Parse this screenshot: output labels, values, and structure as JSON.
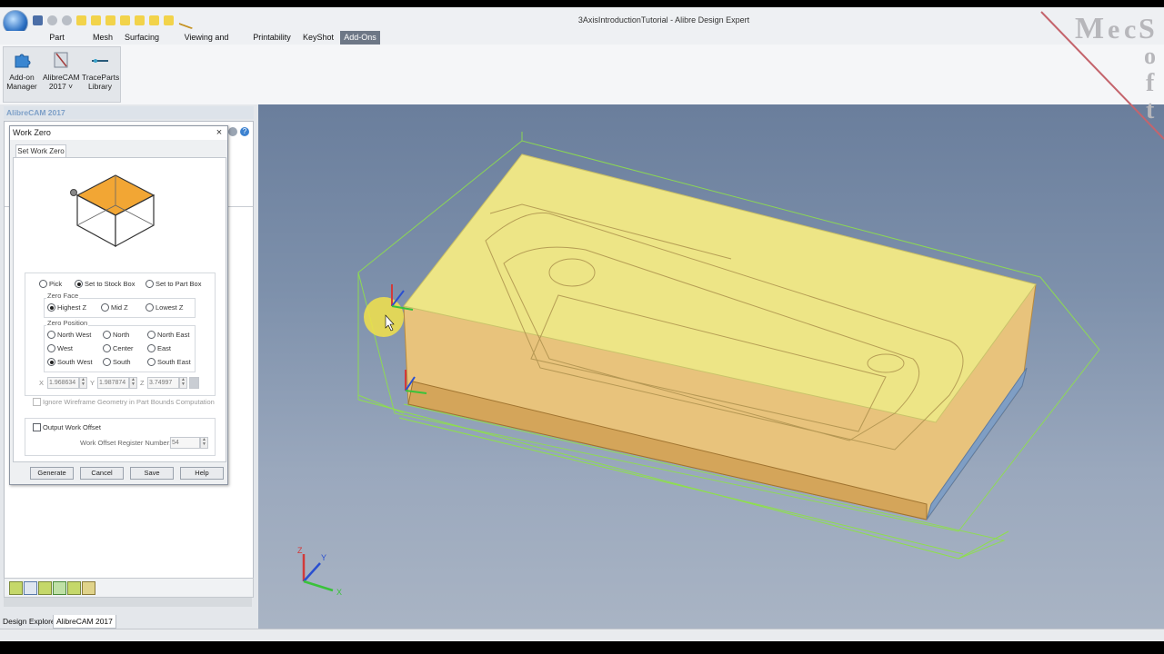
{
  "window": {
    "title": "3AxisIntroductionTutorial - Alibre Design Expert"
  },
  "ribbon": {
    "tabs": [
      "Part Modeling",
      "Mesh",
      "Surfacing",
      "Viewing and Analysis",
      "Printability",
      "KeyShot",
      "Add-Ons"
    ],
    "active_tab": "Add-Ons",
    "buttons": [
      {
        "label": "Add-on\nManager",
        "icon": "puzzle-icon"
      },
      {
        "label": "AlibreCAM\n2017 ˅",
        "icon": "alibrecam-icon"
      },
      {
        "label": "TraceParts\nLibrary",
        "icon": "traceparts-icon"
      }
    ]
  },
  "panel": {
    "title": "AlibreCAM 2017"
  },
  "bottom_tabs": [
    "Design Explorer",
    "AlibreCAM 2017"
  ],
  "dialog": {
    "title": "Work Zero",
    "tab": "Set Work Zero",
    "mode_options": [
      {
        "label": "Pick",
        "checked": false
      },
      {
        "label": "Set to Stock Box",
        "checked": true
      },
      {
        "label": "Set to Part Box",
        "checked": false
      }
    ],
    "zero_face": {
      "title": "Zero Face",
      "options": [
        {
          "label": "Highest Z",
          "checked": true
        },
        {
          "label": "Mid Z",
          "checked": false
        },
        {
          "label": "Lowest Z",
          "checked": false
        }
      ]
    },
    "zero_position": {
      "title": "Zero Position",
      "options": [
        {
          "label": "North West",
          "checked": false
        },
        {
          "label": "North",
          "checked": false
        },
        {
          "label": "North East",
          "checked": false
        },
        {
          "label": "West",
          "checked": false
        },
        {
          "label": "Center",
          "checked": false
        },
        {
          "label": "East",
          "checked": false
        },
        {
          "label": "South West",
          "checked": true
        },
        {
          "label": "South",
          "checked": false
        },
        {
          "label": "South East",
          "checked": false
        }
      ]
    },
    "coords": {
      "x_label": "X",
      "x_value": "1.968634",
      "y_label": "Y",
      "y_value": "1.987874",
      "z_label": "Z",
      "z_value": "3.74997"
    },
    "ignore_wireframe": "Ignore Wireframe Geometry in Part Bounds Computation",
    "output_offset": "Output Work Offset",
    "offset_register_label": "Work Offset Register Number:",
    "offset_register_value": "54",
    "buttons": [
      "Generate",
      "Cancel",
      "Save",
      "Help"
    ]
  },
  "watermark": {
    "letters": [
      "M",
      "e",
      "c",
      "S",
      "o",
      "f",
      "t"
    ]
  },
  "colors": {
    "stock": "#ecec7a",
    "part": "#e8c37c",
    "wireframe": "#8ee04a",
    "highlight": "#f2a634"
  }
}
